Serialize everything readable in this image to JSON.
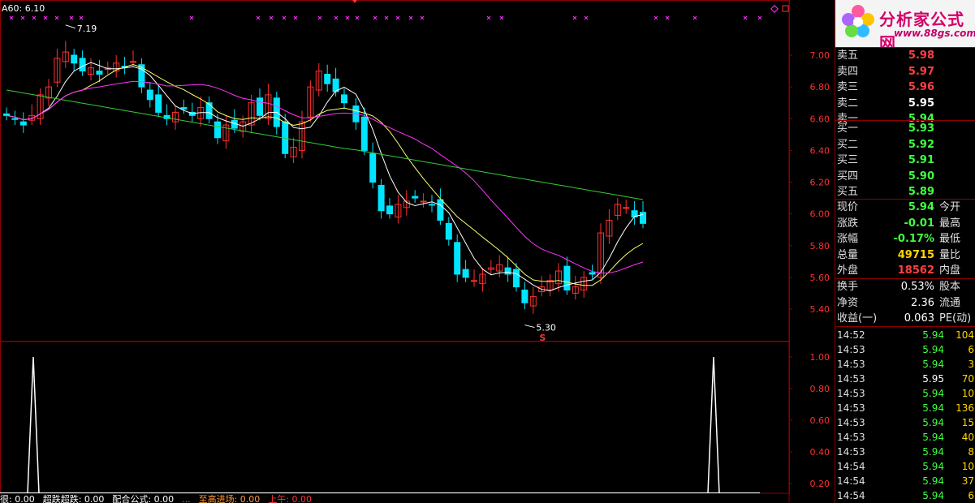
{
  "chart": {
    "ma_label": "A60: 6.10",
    "high_marker": "7.19",
    "low_marker": "5.30",
    "signal_marker": "S",
    "price_ticks": [
      "7.00",
      "6.80",
      "6.60",
      "6.40",
      "6.20",
      "6.00",
      "5.80",
      "5.60",
      "5.40"
    ],
    "indicator_ticks": [
      "1.00",
      "0.80",
      "0.60",
      "0.40",
      "0.20"
    ],
    "colors": {
      "up": "#ff3030",
      "down": "#00e5ff",
      "ma5": "#ffffff",
      "ma10": "#ffff66",
      "ma20": "#ff33ff",
      "ma60": "#33cc33",
      "grid": "#8b0000"
    }
  },
  "bottom_bar": {
    "items": [
      "很: 0.00",
      "超跌超跌: 0.00",
      "配合公式: 0.00",
      "...",
      "至高进场: 0.00",
      "上午: 0.00"
    ]
  },
  "logo": {
    "brand": "分析家公式网",
    "url": "www.88gs.com"
  },
  "sell": [
    {
      "label": "卖五",
      "price": "5.98"
    },
    {
      "label": "卖四",
      "price": "5.97"
    },
    {
      "label": "卖三",
      "price": "5.96"
    },
    {
      "label": "卖二",
      "price": "5.95"
    },
    {
      "label": "卖一",
      "price": "5.94"
    }
  ],
  "buy": [
    {
      "label": "买一",
      "price": "5.93"
    },
    {
      "label": "买二",
      "price": "5.92"
    },
    {
      "label": "买三",
      "price": "5.91"
    },
    {
      "label": "买四",
      "price": "5.90"
    },
    {
      "label": "买五",
      "price": "5.89"
    }
  ],
  "quote": [
    {
      "label": "现价",
      "value": "5.94",
      "label2": "今开"
    },
    {
      "label": "涨跌",
      "value": "-0.01",
      "label2": "最高"
    },
    {
      "label": "涨幅",
      "value": "-0.17%",
      "label2": "最低"
    },
    {
      "label": "总量",
      "value": "49715",
      "label2": "量比"
    },
    {
      "label": "外盘",
      "value": "18562",
      "label2": "内盘"
    }
  ],
  "fundamentals": [
    {
      "label": "换手",
      "value": "0.53%",
      "label2": "股本"
    },
    {
      "label": "净资",
      "value": "2.36",
      "label2": "流通"
    },
    {
      "label": "收益(一)",
      "value": "0.063",
      "label2": "PE(动)"
    }
  ],
  "ticks": [
    {
      "time": "14:52",
      "price": "5.94",
      "vol": "104"
    },
    {
      "time": "14:53",
      "price": "5.94",
      "vol": "6"
    },
    {
      "time": "14:53",
      "price": "5.94",
      "vol": "3"
    },
    {
      "time": "14:53",
      "price": "5.95",
      "vol": "70"
    },
    {
      "time": "14:53",
      "price": "5.94",
      "vol": "10"
    },
    {
      "time": "14:53",
      "price": "5.94",
      "vol": "136"
    },
    {
      "time": "14:53",
      "price": "5.94",
      "vol": "15"
    },
    {
      "time": "14:53",
      "price": "5.94",
      "vol": "40"
    },
    {
      "time": "14:53",
      "price": "5.94",
      "vol": "8"
    },
    {
      "time": "14:54",
      "price": "5.94",
      "vol": "10"
    },
    {
      "time": "14:54",
      "price": "5.94",
      "vol": "37"
    },
    {
      "time": "14:54",
      "price": "5.94",
      "vol": "6"
    }
  ]
}
